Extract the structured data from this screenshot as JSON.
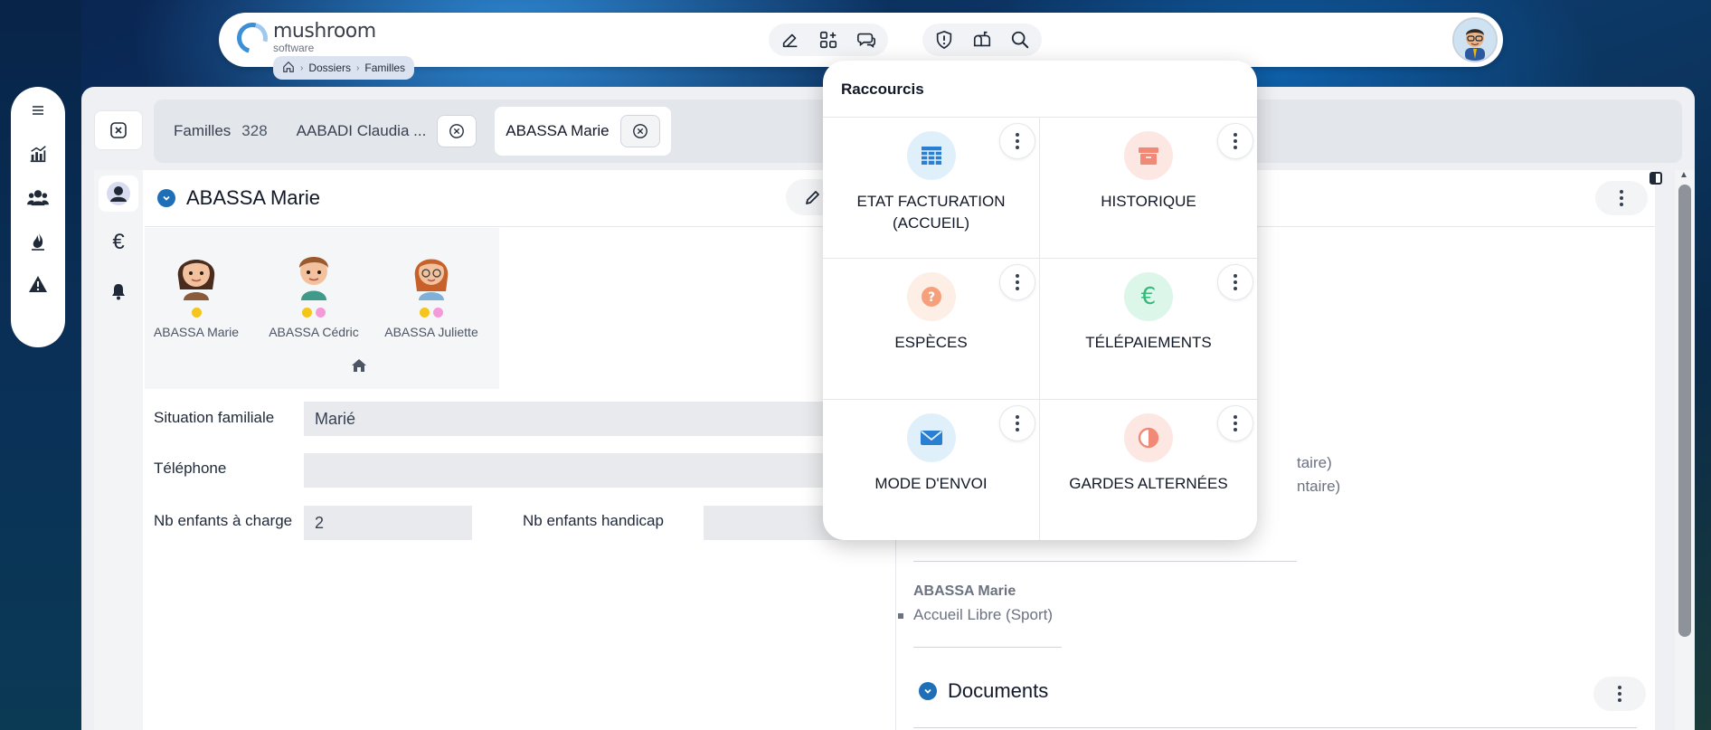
{
  "app": {
    "logo_name": "mushroom",
    "logo_sub": "software"
  },
  "breadcrumb": {
    "items": [
      "Dossiers",
      "Familles"
    ]
  },
  "toolbar": {
    "icons": [
      "edit-icon",
      "add-widget-icon",
      "chat-icon",
      "shield-alert-icon",
      "mailbox-icon",
      "search-icon"
    ]
  },
  "rail": {
    "icons": [
      "menu-icon",
      "chart-icon",
      "users-icon",
      "flame-icon",
      "warning-icon"
    ]
  },
  "tabs": {
    "items": [
      {
        "label": "Familles",
        "count": "328"
      },
      {
        "label": "AABADI Claudia ..."
      },
      {
        "label": "ABASSA Marie"
      }
    ]
  },
  "family": {
    "title": "ABASSA Marie",
    "members": [
      {
        "name": "ABASSA Marie",
        "dots": [
          "#f5c518"
        ]
      },
      {
        "name": "ABASSA Cédric",
        "dots": [
          "#f5c518",
          "#f59ad9"
        ]
      },
      {
        "name": "ABASSA Juliette",
        "dots": [
          "#f5c518",
          "#f59ad9"
        ]
      }
    ]
  },
  "form": {
    "situation_label": "Situation familiale",
    "situation_value": "Marié",
    "telephone_label": "Téléphone",
    "telephone_value": "",
    "children_label": "Nb enfants à charge",
    "children_value": "2",
    "handicap_label": "Nb enfants handicap",
    "handicap_value": ""
  },
  "right": {
    "faded_1": "taire)",
    "faded_2": "ntaire)",
    "person_name": "ABASSA Marie",
    "activity": "Accueil Libre (Sport)",
    "documents_title": "Documents"
  },
  "shortcuts": {
    "title": "Raccourcis",
    "tiles": [
      {
        "label": "ETAT FACTURATION (ACCUEIL)",
        "icon": "table-icon",
        "icon_color": "#2b7fd0",
        "bg": "#dff0fb"
      },
      {
        "label": "HISTORIQUE",
        "icon": "archive-icon",
        "icon_color": "#f08a76",
        "bg": "#fde7e3"
      },
      {
        "label": "ESPÈCES",
        "icon": "question-icon",
        "icon_color": "#f5a07a",
        "bg": "#fdeee6"
      },
      {
        "label": "TÉLÉPAIEMENTS",
        "icon": "euro-icon",
        "icon_color": "#35b87a",
        "bg": "#ddf6ea"
      },
      {
        "label": "MODE D'ENVOI",
        "icon": "envelope-icon",
        "icon_color": "#2b7fd0",
        "bg": "#dff0fb"
      },
      {
        "label": "GARDES ALTERNÉES",
        "icon": "half-circle-icon",
        "icon_color": "#f08a76",
        "bg": "#fde7e3"
      }
    ]
  }
}
